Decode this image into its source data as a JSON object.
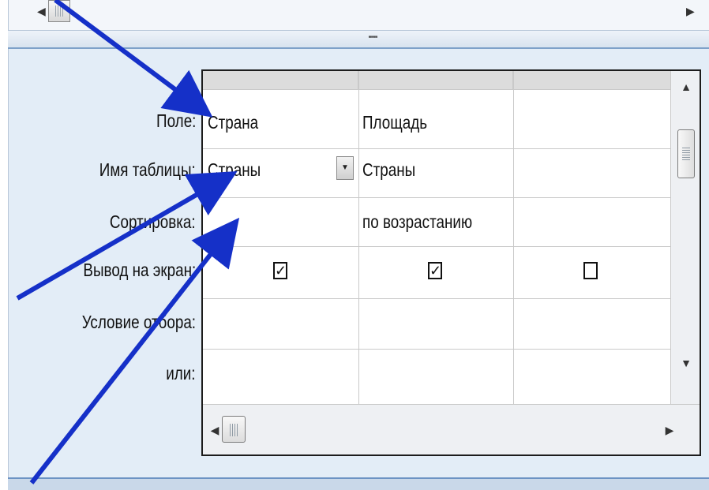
{
  "splitter": {
    "grip_glyph": "''''''''''"
  },
  "row_labels": [
    "Поле:",
    "Имя таблицы:",
    "Сортировка:",
    "Вывод на экран:",
    "Условие отбора:",
    "или:"
  ],
  "columns": [
    {
      "field": "Страна",
      "table": "Страны",
      "sort": "",
      "show": true,
      "has_dropdown": true
    },
    {
      "field": "Площадь",
      "table": "Страны",
      "sort": "по возрастанию",
      "show": true,
      "has_dropdown": false
    },
    {
      "field": "",
      "table": "",
      "sort": "",
      "show": false,
      "has_dropdown": false
    }
  ],
  "glyphs": {
    "check": "✓",
    "dropdown": "▼",
    "up": "▲",
    "down": "▼",
    "left": "◀",
    "right": "▶"
  },
  "icons": {
    "dropdown": "chevron-down-icon",
    "scroll_up": "arrow-up-icon",
    "scroll_down": "arrow-down-icon",
    "scroll_left": "arrow-left-icon",
    "scroll_right": "arrow-right-icon"
  },
  "colors": {
    "arrow": "#1530c8",
    "panel_bg": "#e3edf7",
    "grid_border": "#1c1c1c"
  }
}
